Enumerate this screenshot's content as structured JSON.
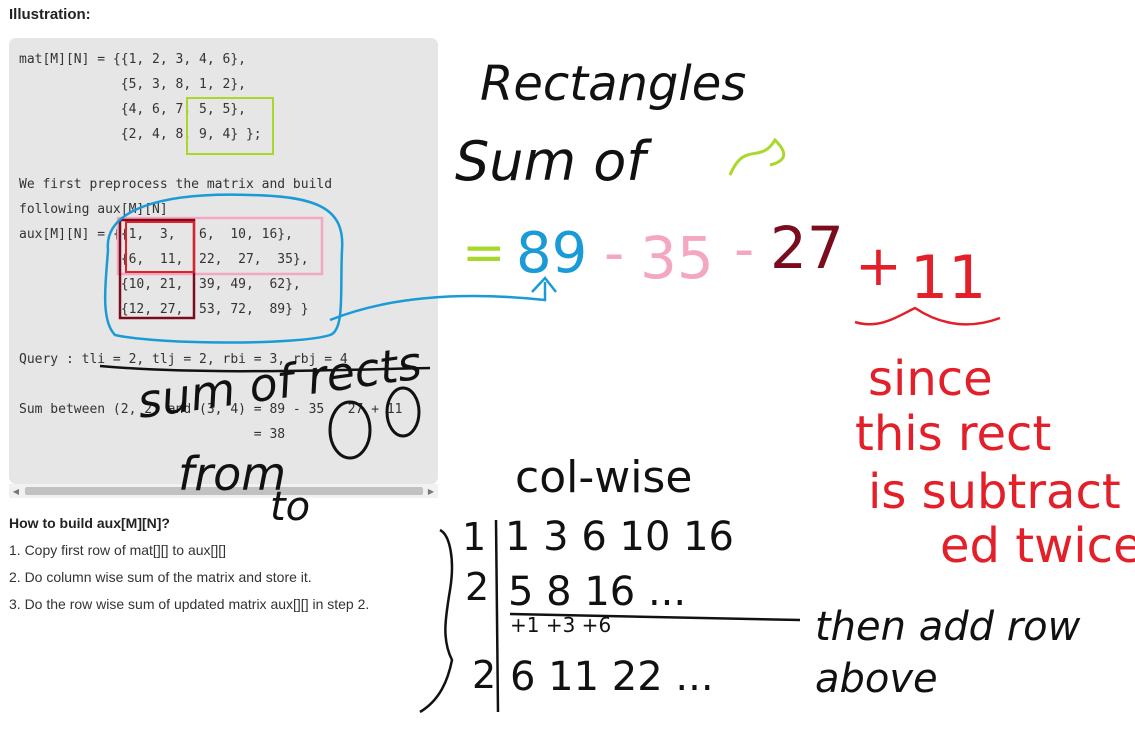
{
  "heading": "Illustration:",
  "code_lines": [
    "mat[M][N] = {{1, 2, 3, 4, 6},",
    "             {5, 3, 8, 1, 2},",
    "             {4, 6, 7, 5, 5},",
    "             {2, 4, 8, 9, 4} };",
    "",
    "We first preprocess the matrix and build",
    "following aux[M][N]",
    "aux[M][N] = {{1,  3,   6,  10, 16},",
    "             {6,  11,  22,  27,  35},",
    "             {10, 21,  39, 49,  62},",
    "             {12, 27,  53, 72,  89} }",
    "",
    "Query : tli = 2, tlj = 2, rbi = 3, rbj = 4",
    "",
    "Sum between (2, 2) and (3, 4) = 89 - 35 - 27 + 11",
    "                              = 38"
  ],
  "howto_title": "How to build aux[M][N]?",
  "steps": [
    "1. Copy first row of mat[][] to aux[][]",
    "2. Do column wise sum of the matrix and store it.",
    "3. Do the row wise sum of updated matrix aux[][] in step 2."
  ],
  "annotations": {
    "rectangles": "Rectangles",
    "sum_of": "Sum of",
    "eq": "=",
    "v89": "89",
    "minus1": "-",
    "v35": "35",
    "minus2": "-",
    "v27": "27",
    "plus": "+",
    "v11": "11",
    "since": "since",
    "this_rect": "this rect",
    "is_subtract": "is subtract",
    "ed_twice": "ed twice",
    "sum_of_rects": "sum of rects",
    "from": "from",
    "to": "to",
    "col_wise": "col-wise",
    "row1_label": "1",
    "row1": "1 3 6 10 16",
    "row2_label": "2",
    "row2": "5 8 16 ...",
    "row2_add": "+1 +3 +6",
    "row3_label": "2",
    "row3": "6 11 22 ...",
    "then_add": "then add row",
    "above": "above"
  },
  "colors": {
    "blue": "#1a9ad6",
    "pink": "#f3a7c0",
    "maroon": "#7a0c1e",
    "red": "#e3202a",
    "lime": "#a8d82a",
    "ink": "#111111"
  }
}
